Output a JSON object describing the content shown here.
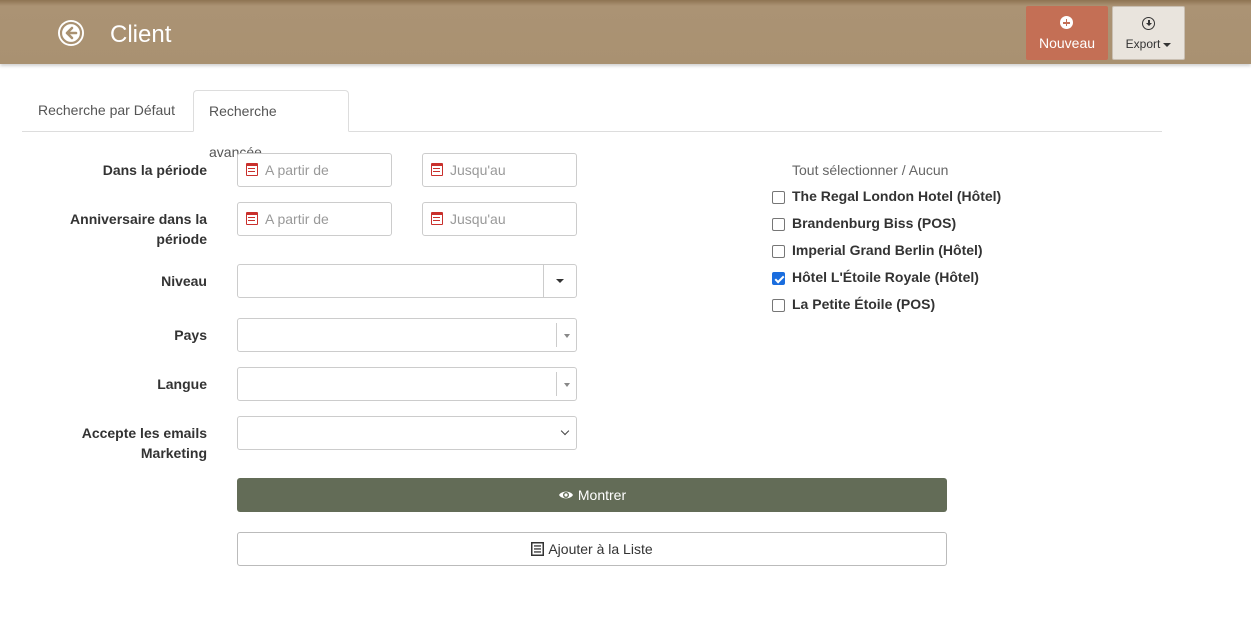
{
  "header": {
    "title": "Client",
    "new_label": "Nouveau",
    "export_label": "Export"
  },
  "tabs": [
    {
      "label": "Recherche par Défaut"
    },
    {
      "label": "Recherche avancée"
    }
  ],
  "form": {
    "period": {
      "label": "Dans la période",
      "from_placeholder": "A partir de",
      "to_placeholder": "Jusqu'au"
    },
    "birthday": {
      "label_line1": "Anniversaire dans la",
      "label_line2": "période",
      "from_placeholder": "A partir de",
      "to_placeholder": "Jusqu'au"
    },
    "level": {
      "label": "Niveau",
      "value": ""
    },
    "country": {
      "label": "Pays",
      "value": ""
    },
    "language": {
      "label": "Langue",
      "value": ""
    },
    "marketing": {
      "label_line1": "Accepte les emails",
      "label_line2": "Marketing",
      "value": ""
    }
  },
  "actions": {
    "show_label": "Montrer",
    "add_label": "Ajouter à la Liste"
  },
  "properties": {
    "select_all": "Tout sélectionner",
    "separator": "/",
    "none": "Aucun",
    "items": [
      {
        "label": "The Regal London Hotel (Hôtel)",
        "checked": false
      },
      {
        "label": "Brandenburg Biss (POS)",
        "checked": false
      },
      {
        "label": "Imperial Grand Berlin (Hôtel)",
        "checked": false
      },
      {
        "label": "Hôtel L'Étoile Royale (Hôtel)",
        "checked": true
      },
      {
        "label": "La Petite Étoile (POS)",
        "checked": false
      }
    ]
  }
}
